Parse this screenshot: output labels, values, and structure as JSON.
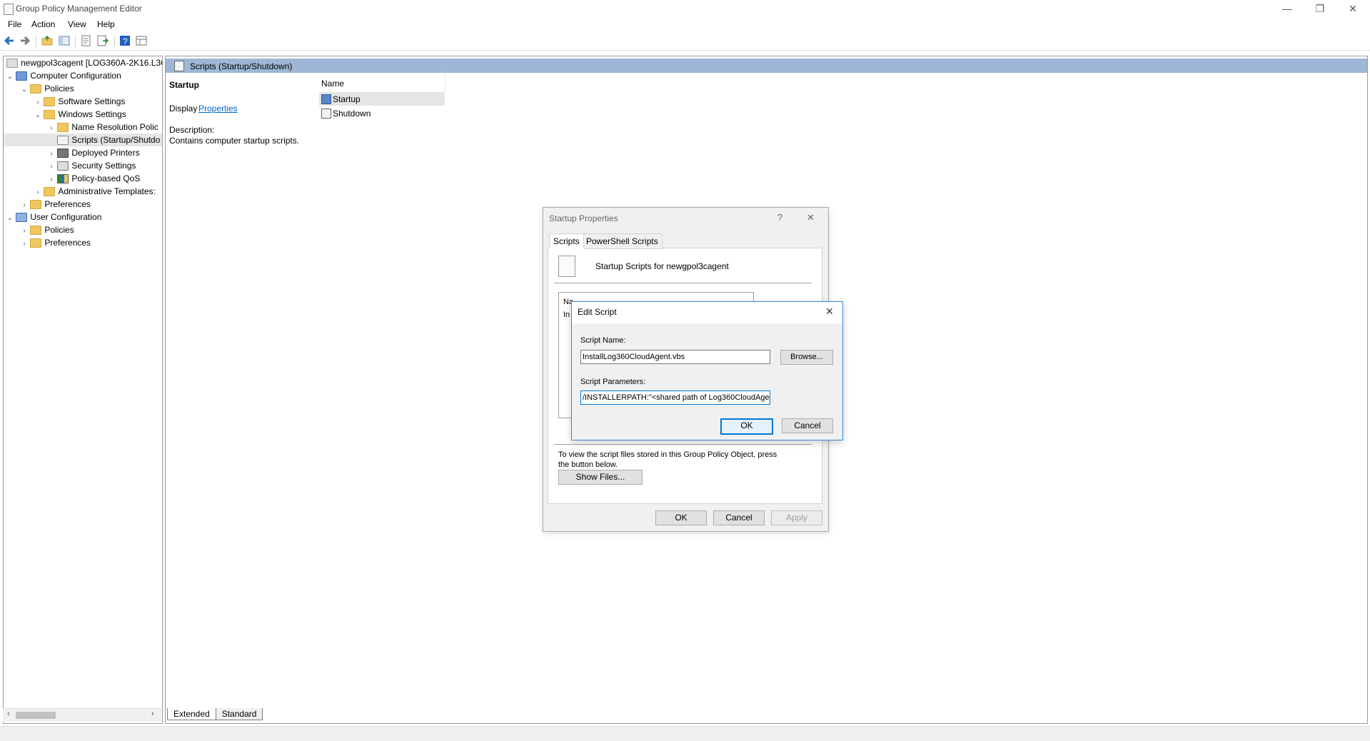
{
  "window": {
    "title": "Group Policy Management Editor",
    "min": "—",
    "restore": "❐",
    "close": "✕"
  },
  "menu": [
    "File",
    "Action",
    "View",
    "Help"
  ],
  "tree": {
    "root": "newgpol3cagent [LOG360A-2K16.L3C",
    "computer_config": "Computer Configuration",
    "policies": "Policies",
    "software_settings": "Software Settings",
    "windows_settings": "Windows Settings",
    "name_resolution": "Name Resolution Polic",
    "scripts": "Scripts (Startup/Shutdo",
    "deployed_printers": "Deployed Printers",
    "security_settings": "Security Settings",
    "policy_qos": "Policy-based QoS",
    "admin_templates": "Administrative Templates:",
    "preferences": "Preferences",
    "user_config": "User Configuration",
    "user_policies": "Policies",
    "user_preferences": "Preferences"
  },
  "right": {
    "header": "Scripts (Startup/Shutdown)",
    "heading": "Startup",
    "display_label": "Display",
    "properties_link": "Properties",
    "description_label": "Description:",
    "description_text": "Contains computer startup scripts.",
    "column_name": "Name",
    "items": [
      "Startup",
      "Shutdown"
    ]
  },
  "bottom_tabs": [
    "Extended",
    "Standard"
  ],
  "startup_dialog": {
    "title": "Startup Properties",
    "help": "?",
    "close": "✕",
    "tabs": [
      "Scripts",
      "PowerShell Scripts"
    ],
    "header_text": "Startup Scripts for newgpol3cagent",
    "partial_1": "Na",
    "partial_2": "In",
    "info_text": "To view the script files stored in this Group Policy Object, press the button below.",
    "show_files": "Show Files...",
    "ok": "OK",
    "cancel": "Cancel",
    "apply": "Apply"
  },
  "edit_dialog": {
    "title": "Edit Script",
    "close": "✕",
    "script_name_label": "Script Name:",
    "script_name_value": "InstallLog360CloudAgent.vbs",
    "browse": "Browse...",
    "script_params_label": "Script Parameters:",
    "script_params_value": "/INSTALLERPATH:\"<shared path of Log360CloudAge",
    "ok": "OK",
    "cancel": "Cancel"
  },
  "colors": {
    "accent": "#0078d7",
    "header": "#9fb7d6",
    "folder": "#f0c75e"
  },
  "icons": [
    "back-icon",
    "forward-icon",
    "up-folder-icon",
    "show-tree-icon",
    "export-icon",
    "properties-icon",
    "help-icon",
    "view-icon",
    "script-icon"
  ]
}
